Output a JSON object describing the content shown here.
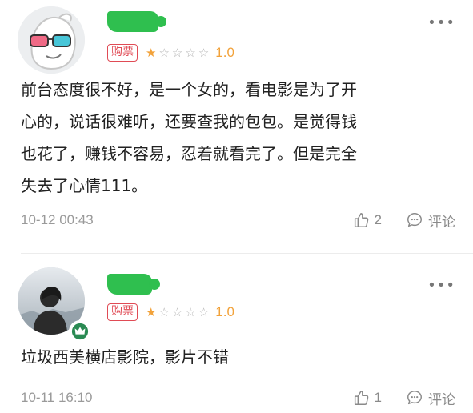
{
  "reviews": [
    {
      "badge": "购票",
      "stars": [
        1,
        0,
        0,
        0,
        0
      ],
      "rating": "1.0",
      "content": "前台态度很不好，是一个女的，看电影是为了开\n心的，说话很难听，还要查我的包包。是觉得钱\n也花了，赚钱不容易，忍着就看完了。但是完全\n失去了心情111。",
      "time": "10-12 00:43",
      "likes": "2",
      "comment_label": "评论"
    },
    {
      "badge": "购票",
      "stars": [
        1,
        0,
        0,
        0,
        0
      ],
      "rating": "1.0",
      "content": "垃圾西美横店影院，影片不错",
      "time": "10-11 16:10",
      "likes": "1",
      "comment_label": "评论"
    }
  ],
  "colors": {
    "badge": "#e04b55",
    "star_active": "#f2a23a",
    "star_inactive": "#b3b3b3",
    "muted": "#8a8a8a",
    "name_blob": "#2fbf4f",
    "crown": "#2a8a53"
  }
}
